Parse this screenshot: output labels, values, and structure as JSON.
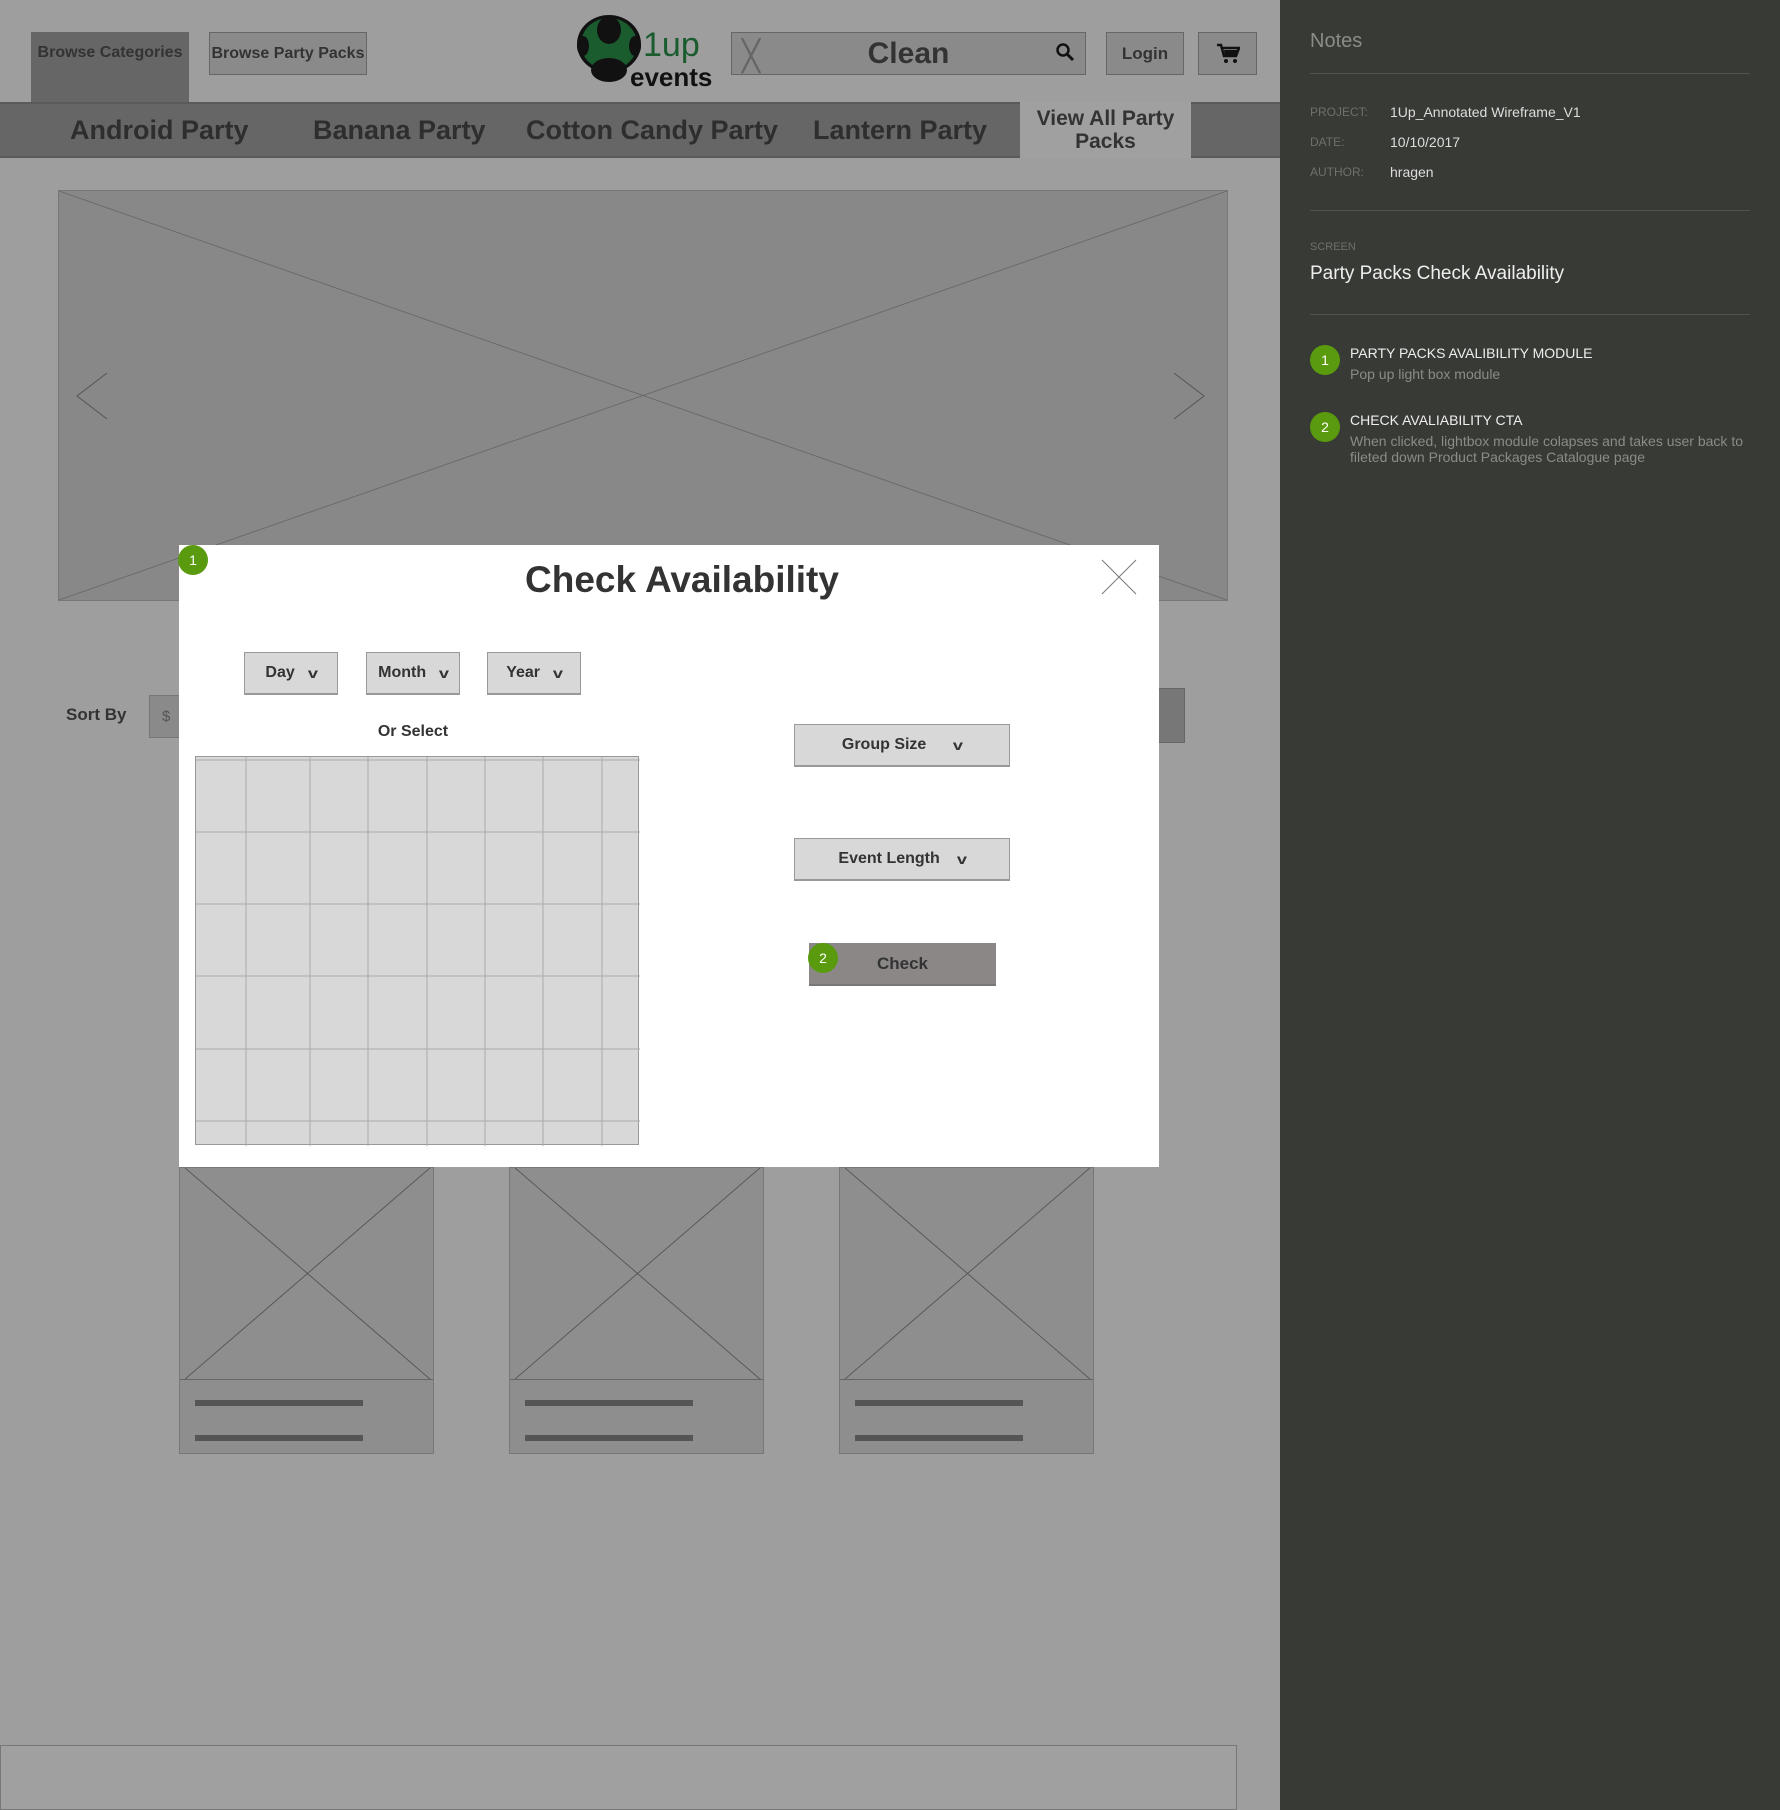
{
  "header": {
    "browse_categories": "Browse Categories",
    "browse_party_packs": "Browse Party Packs",
    "logo": {
      "line1": "1up",
      "line2": "events",
      "color": "#1a5c2e"
    },
    "search": {
      "value": "Clean",
      "clear_icon": "close-icon",
      "search_icon": "search-icon"
    },
    "login": "Login",
    "cart_icon": "cart-icon"
  },
  "nav": {
    "items": [
      "Android Party",
      "Banana Party",
      "Cotton Candy Party",
      "Lantern Party"
    ],
    "view_all": "View All Party Packs"
  },
  "carousel": {
    "prev_icon": "chevron-left-icon",
    "next_icon": "chevron-right-icon"
  },
  "sort": {
    "label": "Sort By",
    "value": "$"
  },
  "modal": {
    "badge": "1",
    "title": "Check Availability",
    "day": "Day",
    "month": "Month",
    "year": "Year",
    "or_select": "Or Select",
    "group_size": "Group Size",
    "event_length": "Event Length",
    "check": "Check",
    "check_badge": "2"
  },
  "notes": {
    "title": "Notes",
    "project_label": "PROJECT:",
    "project": "1Up_Annotated Wireframe_V1",
    "date_label": "DATE:",
    "date": "10/10/2017",
    "author_label": "AUTHOR:",
    "author": "hragen",
    "screen_label": "SCREEN",
    "screen": "Party Packs Check Availability",
    "items": [
      {
        "num": "1",
        "title": "PARTY PACKS AVALIBILITY MODULE",
        "desc": "Pop up light box module"
      },
      {
        "num": "2",
        "title": "CHECK AVALIABILITY CTA",
        "desc": "When clicked, lightbox module colapses and takes user back to fileted down Product Packages Catalogue page"
      }
    ],
    "accent": "#5a9a0f"
  }
}
